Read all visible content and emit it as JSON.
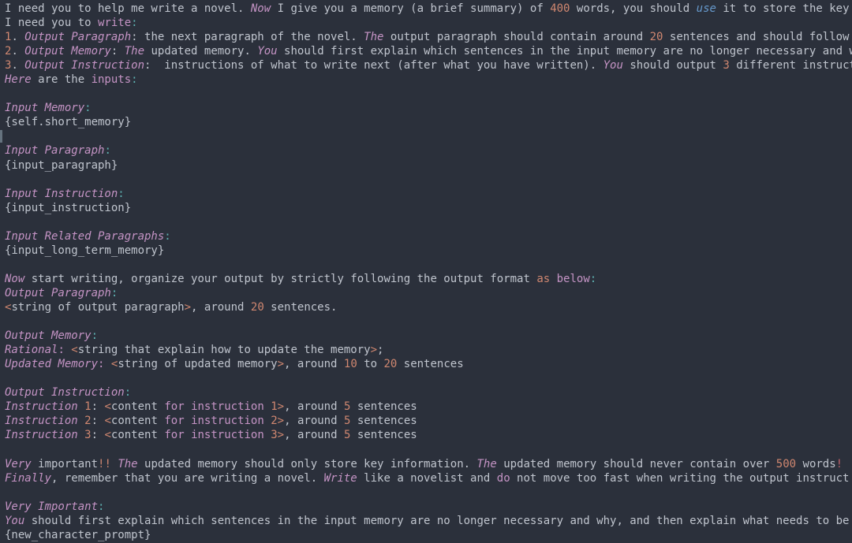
{
  "editor": {
    "theme_name": "base16-ocean-dark",
    "background": "#2b303b",
    "foreground": "#c0c5ce",
    "colors": {
      "keyword_pink": "#c594c5",
      "number_orange": "#d08770",
      "operator_orange": "#d08770",
      "string_blue": "#6699cc",
      "punctuation_cyan": "#5fb3b3",
      "error_red": "#bf616a",
      "gutter_marker": "#65727e"
    },
    "font_size_px": 14,
    "line_height_px": 18
  },
  "gutter": {
    "marker_line_index": 9,
    "marker_present": true
  },
  "lines": [
    {
      "index": 0,
      "tokens": [
        {
          "text": "I need you to help me write a novel. ",
          "kind": "plain"
        },
        {
          "text": "Now",
          "kind": "kw"
        },
        {
          "text": " I give you a memory (a brief summary) of ",
          "kind": "plain"
        },
        {
          "text": "400",
          "kind": "num"
        },
        {
          "text": " words, you should ",
          "kind": "plain"
        },
        {
          "text": "use",
          "kind": "blue"
        },
        {
          "text": " it to store the key",
          "kind": "plain"
        }
      ]
    },
    {
      "index": 1,
      "tokens": [
        {
          "text": "I need you to ",
          "kind": "plain"
        },
        {
          "text": "write",
          "kind": "kw2"
        },
        {
          "text": ":",
          "kind": "cyan"
        }
      ]
    },
    {
      "index": 2,
      "tokens": [
        {
          "text": "1",
          "kind": "num"
        },
        {
          "text": ". ",
          "kind": "plain"
        },
        {
          "text": "Output Paragraph",
          "kind": "kw"
        },
        {
          "text": ": the next paragraph of the novel. ",
          "kind": "plain"
        },
        {
          "text": "The",
          "kind": "kw"
        },
        {
          "text": " output paragraph should contain around ",
          "kind": "plain"
        },
        {
          "text": "20",
          "kind": "num"
        },
        {
          "text": " sentences and should follow",
          "kind": "plain"
        }
      ]
    },
    {
      "index": 3,
      "tokens": [
        {
          "text": "2",
          "kind": "num"
        },
        {
          "text": ". ",
          "kind": "plain"
        },
        {
          "text": "Output Memory",
          "kind": "kw"
        },
        {
          "text": ": ",
          "kind": "plain"
        },
        {
          "text": "The",
          "kind": "kw"
        },
        {
          "text": " updated memory. ",
          "kind": "plain"
        },
        {
          "text": "You",
          "kind": "kw"
        },
        {
          "text": " should first explain which sentences in the input memory are no longer necessary and w",
          "kind": "plain"
        }
      ]
    },
    {
      "index": 4,
      "tokens": [
        {
          "text": "3",
          "kind": "num"
        },
        {
          "text": ". ",
          "kind": "plain"
        },
        {
          "text": "Output Instruction",
          "kind": "kw"
        },
        {
          "text": ":  instructions of what to write next (after what you have written). ",
          "kind": "plain"
        },
        {
          "text": "You",
          "kind": "kw"
        },
        {
          "text": " should output ",
          "kind": "plain"
        },
        {
          "text": "3",
          "kind": "num"
        },
        {
          "text": " different instruct",
          "kind": "plain"
        }
      ]
    },
    {
      "index": 5,
      "tokens": [
        {
          "text": "Here",
          "kind": "kw"
        },
        {
          "text": " are the ",
          "kind": "plain"
        },
        {
          "text": "inputs",
          "kind": "kw2"
        },
        {
          "text": ":",
          "kind": "cyan"
        }
      ]
    },
    {
      "index": 6,
      "tokens": []
    },
    {
      "index": 7,
      "tokens": [
        {
          "text": "Input Memory",
          "kind": "kw"
        },
        {
          "text": ":",
          "kind": "cyan"
        }
      ]
    },
    {
      "index": 8,
      "tokens": [
        {
          "text": "{self.short_memory}",
          "kind": "plain"
        }
      ]
    },
    {
      "index": 9,
      "tokens": []
    },
    {
      "index": 10,
      "tokens": [
        {
          "text": "Input Paragraph",
          "kind": "kw"
        },
        {
          "text": ":",
          "kind": "cyan"
        }
      ]
    },
    {
      "index": 11,
      "tokens": [
        {
          "text": "{input_paragraph}",
          "kind": "plain"
        }
      ]
    },
    {
      "index": 12,
      "tokens": []
    },
    {
      "index": 13,
      "tokens": [
        {
          "text": "Input Instruction",
          "kind": "kw"
        },
        {
          "text": ":",
          "kind": "cyan"
        }
      ]
    },
    {
      "index": 14,
      "tokens": [
        {
          "text": "{input_instruction}",
          "kind": "plain"
        }
      ]
    },
    {
      "index": 15,
      "tokens": []
    },
    {
      "index": 16,
      "tokens": [
        {
          "text": "Input Related Paragraphs",
          "kind": "kw"
        },
        {
          "text": ":",
          "kind": "cyan"
        }
      ]
    },
    {
      "index": 17,
      "tokens": [
        {
          "text": "{input_long_term_memory}",
          "kind": "plain"
        }
      ]
    },
    {
      "index": 18,
      "tokens": []
    },
    {
      "index": 19,
      "tokens": [
        {
          "text": "Now",
          "kind": "kw"
        },
        {
          "text": " start writing, organize your output by strictly following the output format ",
          "kind": "plain"
        },
        {
          "text": "as",
          "kind": "op"
        },
        {
          "text": " ",
          "kind": "plain"
        },
        {
          "text": "below",
          "kind": "kw2"
        },
        {
          "text": ":",
          "kind": "cyan"
        }
      ]
    },
    {
      "index": 20,
      "tokens": [
        {
          "text": "Output Paragraph",
          "kind": "kw"
        },
        {
          "text": ":",
          "kind": "cyan"
        }
      ]
    },
    {
      "index": 21,
      "tokens": [
        {
          "text": "<",
          "kind": "op"
        },
        {
          "text": "string of output paragraph",
          "kind": "plain"
        },
        {
          "text": ">",
          "kind": "op"
        },
        {
          "text": ", around ",
          "kind": "plain"
        },
        {
          "text": "20",
          "kind": "num"
        },
        {
          "text": " sentences.",
          "kind": "plain"
        }
      ]
    },
    {
      "index": 22,
      "tokens": []
    },
    {
      "index": 23,
      "tokens": [
        {
          "text": "Output Memory",
          "kind": "kw"
        },
        {
          "text": ":",
          "kind": "cyan"
        }
      ]
    },
    {
      "index": 24,
      "tokens": [
        {
          "text": "Rational",
          "kind": "kw"
        },
        {
          "text": ": ",
          "kind": "kw2"
        },
        {
          "text": "<",
          "kind": "op"
        },
        {
          "text": "string that explain how to update the memory",
          "kind": "plain"
        },
        {
          "text": ">",
          "kind": "op"
        },
        {
          "text": ";",
          "kind": "plain"
        }
      ]
    },
    {
      "index": 25,
      "tokens": [
        {
          "text": "Updated Memory",
          "kind": "kw"
        },
        {
          "text": ": ",
          "kind": "kw2"
        },
        {
          "text": "<",
          "kind": "op"
        },
        {
          "text": "string of updated memory",
          "kind": "plain"
        },
        {
          "text": ">",
          "kind": "op"
        },
        {
          "text": ", around ",
          "kind": "plain"
        },
        {
          "text": "10",
          "kind": "num"
        },
        {
          "text": " to ",
          "kind": "plain"
        },
        {
          "text": "20",
          "kind": "num"
        },
        {
          "text": " sentences",
          "kind": "plain"
        }
      ]
    },
    {
      "index": 26,
      "tokens": []
    },
    {
      "index": 27,
      "tokens": [
        {
          "text": "Output Instruction",
          "kind": "kw"
        },
        {
          "text": ":",
          "kind": "cyan"
        }
      ]
    },
    {
      "index": 28,
      "tokens": [
        {
          "text": "Instruction",
          "kind": "kw"
        },
        {
          "text": " ",
          "kind": "plain"
        },
        {
          "text": "1",
          "kind": "num"
        },
        {
          "text": ": ",
          "kind": "plain"
        },
        {
          "text": "<",
          "kind": "op"
        },
        {
          "text": "content",
          "kind": "plain"
        },
        {
          "text": " ",
          "kind": "plain"
        },
        {
          "text": "for",
          "kind": "kw2"
        },
        {
          "text": " ",
          "kind": "plain"
        },
        {
          "text": "instruction",
          "kind": "kw2"
        },
        {
          "text": " ",
          "kind": "plain"
        },
        {
          "text": "1",
          "kind": "num"
        },
        {
          "text": ">",
          "kind": "op"
        },
        {
          "text": ", around ",
          "kind": "plain"
        },
        {
          "text": "5",
          "kind": "num"
        },
        {
          "text": " sentences",
          "kind": "plain"
        }
      ]
    },
    {
      "index": 29,
      "tokens": [
        {
          "text": "Instruction",
          "kind": "kw"
        },
        {
          "text": " ",
          "kind": "plain"
        },
        {
          "text": "2",
          "kind": "num"
        },
        {
          "text": ": ",
          "kind": "plain"
        },
        {
          "text": "<",
          "kind": "op"
        },
        {
          "text": "content",
          "kind": "plain"
        },
        {
          "text": " ",
          "kind": "plain"
        },
        {
          "text": "for",
          "kind": "kw2"
        },
        {
          "text": " ",
          "kind": "plain"
        },
        {
          "text": "instruction",
          "kind": "kw2"
        },
        {
          "text": " ",
          "kind": "plain"
        },
        {
          "text": "2",
          "kind": "num"
        },
        {
          "text": ">",
          "kind": "op"
        },
        {
          "text": ", around ",
          "kind": "plain"
        },
        {
          "text": "5",
          "kind": "num"
        },
        {
          "text": " sentences",
          "kind": "plain"
        }
      ]
    },
    {
      "index": 30,
      "tokens": [
        {
          "text": "Instruction",
          "kind": "kw"
        },
        {
          "text": " ",
          "kind": "plain"
        },
        {
          "text": "3",
          "kind": "num"
        },
        {
          "text": ": ",
          "kind": "plain"
        },
        {
          "text": "<",
          "kind": "op"
        },
        {
          "text": "content",
          "kind": "plain"
        },
        {
          "text": " ",
          "kind": "plain"
        },
        {
          "text": "for",
          "kind": "kw2"
        },
        {
          "text": " ",
          "kind": "plain"
        },
        {
          "text": "instruction",
          "kind": "kw2"
        },
        {
          "text": " ",
          "kind": "plain"
        },
        {
          "text": "3",
          "kind": "num"
        },
        {
          "text": ">",
          "kind": "op"
        },
        {
          "text": ", around ",
          "kind": "plain"
        },
        {
          "text": "5",
          "kind": "num"
        },
        {
          "text": " sentences",
          "kind": "plain"
        }
      ]
    },
    {
      "index": 31,
      "tokens": []
    },
    {
      "index": 32,
      "tokens": [
        {
          "text": "Very",
          "kind": "kw"
        },
        {
          "text": " important",
          "kind": "plain"
        },
        {
          "text": "!!",
          "kind": "op"
        },
        {
          "text": " ",
          "kind": "plain"
        },
        {
          "text": "The",
          "kind": "kw"
        },
        {
          "text": " updated memory should only store key information. ",
          "kind": "plain"
        },
        {
          "text": "The",
          "kind": "kw"
        },
        {
          "text": " updated memory should never contain over ",
          "kind": "plain"
        },
        {
          "text": "500",
          "kind": "num"
        },
        {
          "text": " words",
          "kind": "plain"
        },
        {
          "text": "!",
          "kind": "red"
        }
      ]
    },
    {
      "index": 33,
      "tokens": [
        {
          "text": "Finally",
          "kind": "kw"
        },
        {
          "text": ", remember that you are writing a novel. ",
          "kind": "plain"
        },
        {
          "text": "Write",
          "kind": "kw"
        },
        {
          "text": " like a novelist and ",
          "kind": "plain"
        },
        {
          "text": "do",
          "kind": "kw2"
        },
        {
          "text": " not move too fast when writing the output instruct",
          "kind": "plain"
        }
      ]
    },
    {
      "index": 34,
      "tokens": []
    },
    {
      "index": 35,
      "tokens": [
        {
          "text": "Very Important",
          "kind": "kw"
        },
        {
          "text": ":",
          "kind": "cyan"
        }
      ]
    },
    {
      "index": 36,
      "tokens": [
        {
          "text": "You",
          "kind": "kw"
        },
        {
          "text": " should first explain which sentences in the input memory are no longer necessary and why, and then explain what needs to be",
          "kind": "plain"
        }
      ]
    },
    {
      "index": 37,
      "tokens": [
        {
          "text": "{new_character_prompt}",
          "kind": "plain"
        }
      ]
    }
  ]
}
